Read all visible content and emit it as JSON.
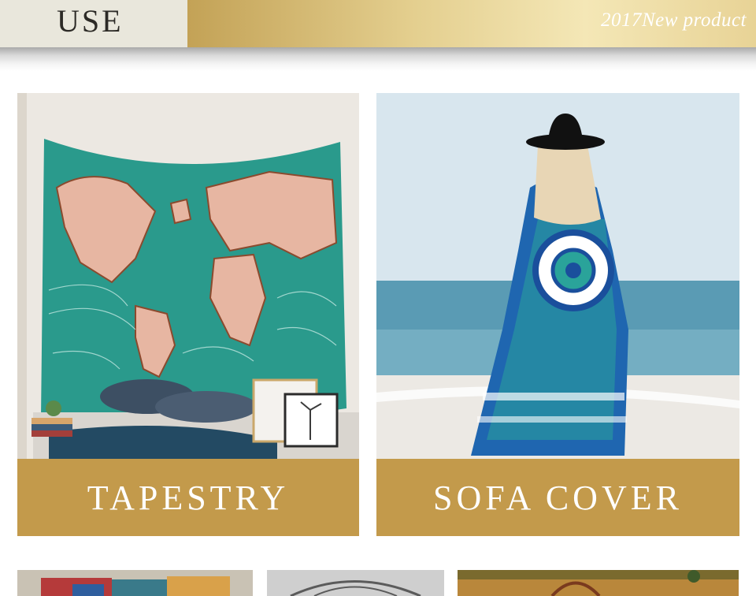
{
  "header": {
    "title": "USE",
    "subtitle": "2017New product"
  },
  "cards": [
    {
      "label": "TAPESTRY",
      "image": "world-map-tapestry-bedroom-photo"
    },
    {
      "label": "SOFA COVER",
      "image": "beach-woman-mandala-throw-photo"
    }
  ],
  "thumbnails": [
    {
      "image": "patchwork-sofa-photo"
    },
    {
      "image": "iron-bed-photo"
    },
    {
      "image": "outdoor-basket-photo"
    }
  ],
  "colors": {
    "label_bar": "#c39a4b",
    "header_gold": "#e4cf8f",
    "header_left": "#e9e7dc"
  }
}
